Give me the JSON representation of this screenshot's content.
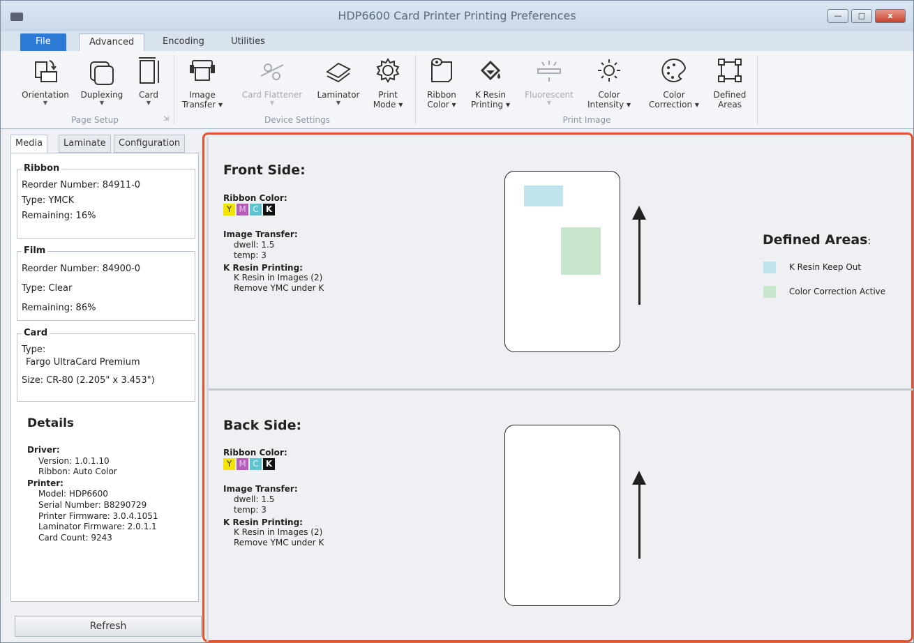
{
  "window": {
    "title": "HDP6600 Card Printer Printing Preferences",
    "minimize": "—",
    "maximize": "□",
    "close": "x"
  },
  "ribbon_tabs": [
    {
      "label": "File"
    },
    {
      "label": "Advanced"
    },
    {
      "label": "Encoding"
    },
    {
      "label": "Utilities"
    }
  ],
  "ribbon": {
    "groups": {
      "page_setup": "Page Setup",
      "device_settings": "Device Settings",
      "print_image": "Print Image"
    },
    "buttons": {
      "orientation": "Orientation",
      "duplexing": "Duplexing",
      "card": "Card",
      "image_transfer_1": "Image",
      "image_transfer_2": "Transfer ▾",
      "card_flattener": "Card Flattener",
      "laminator": "Laminator",
      "print_mode_1": "Print",
      "print_mode_2": "Mode ▾",
      "ribbon_color_1": "Ribbon",
      "ribbon_color_2": "Color ▾",
      "k_resin_1": "K Resin",
      "k_resin_2": "Printing ▾",
      "fluorescent": "Fluorescent",
      "color_intensity_1": "Color",
      "color_intensity_2": "Intensity ▾",
      "color_correction_1": "Color",
      "color_correction_2": "Correction ▾",
      "defined_areas_1": "Defined",
      "defined_areas_2": "Areas"
    }
  },
  "left_tabs": [
    {
      "label": "Media"
    },
    {
      "label": "Laminate"
    },
    {
      "label": "Configuration"
    }
  ],
  "media": {
    "ribbon": {
      "legend": "Ribbon",
      "reorder": "Reorder Number: 84911-0",
      "type": "Type: YMCK",
      "remaining": "Remaining: 16%"
    },
    "film": {
      "legend": "Film",
      "reorder": "Reorder Number: 84900-0",
      "type": "Type: Clear",
      "remaining": "Remaining: 86%"
    },
    "card": {
      "legend": "Card",
      "type": "Type:",
      "type_value": "Fargo UltraCard Premium",
      "size": "Size: CR-80 (2.205\" x 3.453\")"
    }
  },
  "details": {
    "title": "Details",
    "driver_label": "Driver:",
    "version": "Version: 1.0.1.10",
    "ribbon": "Ribbon: Auto Color",
    "printer_label": "Printer:",
    "model": "Model: HDP6600",
    "serial": "Serial Number: B8290729",
    "firmware": "Printer Firmware: 3.0.4.1051",
    "lam_firmware": "Laminator Firmware: 2.0.1.1",
    "card_count": "Card Count: 9243"
  },
  "refresh_label": "Refresh",
  "front": {
    "title": "Front Side:",
    "ribbon_color_label": "Ribbon Color:",
    "ribbon_letters": [
      "Y",
      "M",
      "C",
      "K"
    ],
    "image_transfer_label": "Image Transfer:",
    "dwell": "dwell: 1.5",
    "temp": "temp: 3",
    "k_resin_label": "K Resin Printing:",
    "k_resin_1": "K Resin in Images (2)",
    "k_resin_2": "Remove YMC under K"
  },
  "back": {
    "title": "Back Side:",
    "ribbon_color_label": "Ribbon Color:",
    "ribbon_letters": [
      "Y",
      "M",
      "C",
      "K"
    ],
    "image_transfer_label": "Image Transfer:",
    "dwell": "dwell: 1.5",
    "temp": "temp: 3",
    "k_resin_label": "K Resin Printing:",
    "k_resin_1": "K Resin in Images (2)",
    "k_resin_2": "Remove YMC under K"
  },
  "defined_areas": {
    "title": "Defined Areas",
    "title_suffix": ":",
    "items": [
      {
        "label": "K Resin Keep Out",
        "color": "#bfe3ea"
      },
      {
        "label": "Color Correction Active",
        "color": "#c8e6cc"
      }
    ]
  },
  "colors": {
    "accent_border": "#e4522c",
    "file_tab": "#2b7bd6",
    "ribbon_y": "#f5e400",
    "ribbon_m": "#b35db8",
    "ribbon_c": "#5fc4cf",
    "ribbon_k": "#111111"
  }
}
